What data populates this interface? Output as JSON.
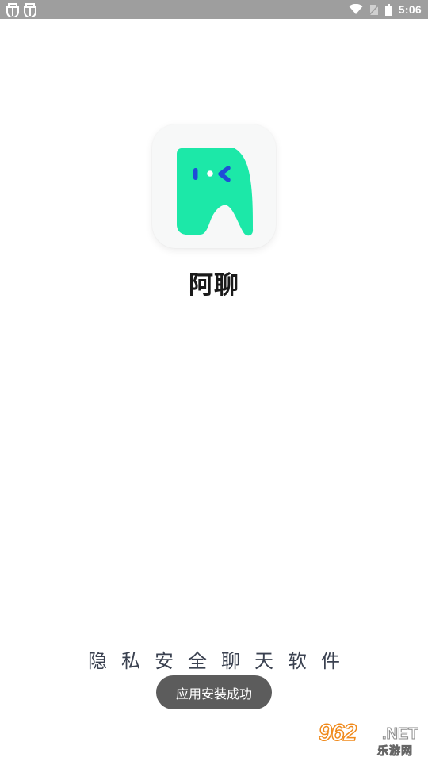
{
  "status_bar": {
    "time": "5:06",
    "left_icons": [
      "debug-bug-icon",
      "debug-bug-icon"
    ],
    "right_icons": [
      "wifi-icon",
      "no-sim-icon",
      "battery-icon"
    ],
    "background": "#9e9e9e"
  },
  "app": {
    "name": "阿聊",
    "icon": "aliao-app-logo",
    "icon_color": "#1ce8a8",
    "icon_accent": "#1f4ed8"
  },
  "slogan": "隐私安全聊天软件",
  "toast": {
    "message": "应用安装成功"
  },
  "watermark": {
    "number": "962",
    "suffix": ".NET",
    "site_name": "乐游网"
  }
}
